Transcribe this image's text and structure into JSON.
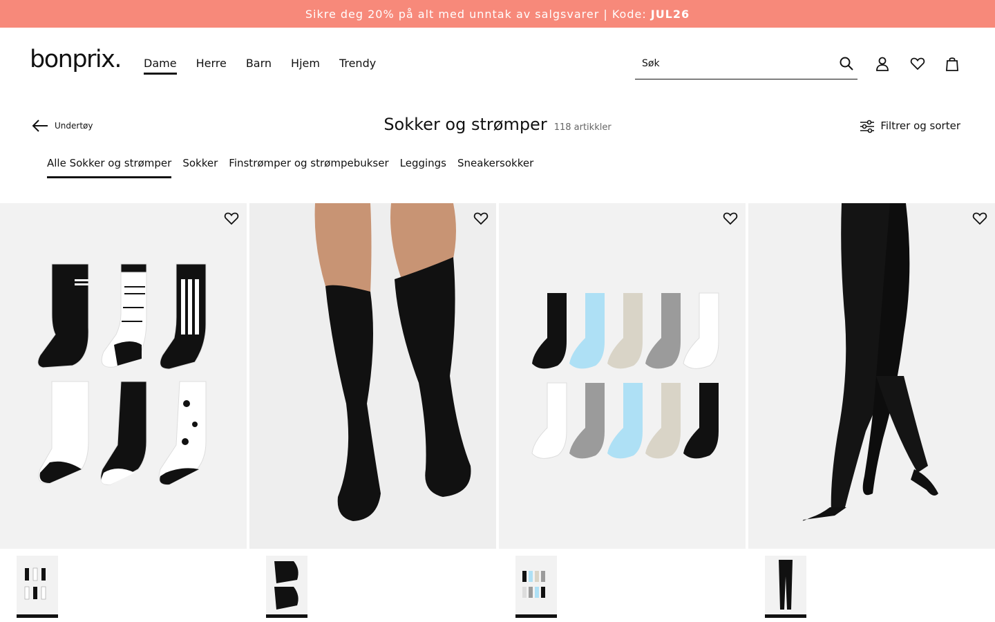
{
  "promo": {
    "text": "Sikre deg 20% på alt med unntak av salgsvarer | Kode:",
    "code": "JUL26"
  },
  "header": {
    "logo": "bonprix.",
    "nav": [
      "Dame",
      "Herre",
      "Barn",
      "Hjem",
      "Trendy"
    ],
    "active_nav": "Dame",
    "search_placeholder": "Søk",
    "icons": [
      "search-icon",
      "account-icon",
      "heart-icon",
      "bag-icon"
    ]
  },
  "page": {
    "back_label": "Undertøy",
    "title": "Sokker og strømper",
    "count": "118 artikkler",
    "filter_label": "Filtrer og sorter"
  },
  "categories": [
    "Alle Sokker og strømper",
    "Sokker",
    "Finstrømper og strømpebukser",
    "Leggings",
    "Sneakersokker"
  ],
  "active_category": "Alle Sokker og strømper",
  "products": [
    {
      "image": "music-socks-6-pack",
      "colors": [
        "#111111",
        "#ffffff"
      ]
    },
    {
      "image": "black-socks-on-legs",
      "colors": [
        "#111111"
      ]
    },
    {
      "image": "ten-pack-socks",
      "colors": [
        "#111111",
        "#aee0f5",
        "#d9d4c7",
        "#9b9b9b",
        "#ffffff"
      ]
    },
    {
      "image": "black-leggings",
      "colors": [
        "#111111"
      ]
    }
  ],
  "colors": {
    "promo_bg": "#f7897a",
    "text": "#111111",
    "image_bg": "#f2f2f2"
  }
}
